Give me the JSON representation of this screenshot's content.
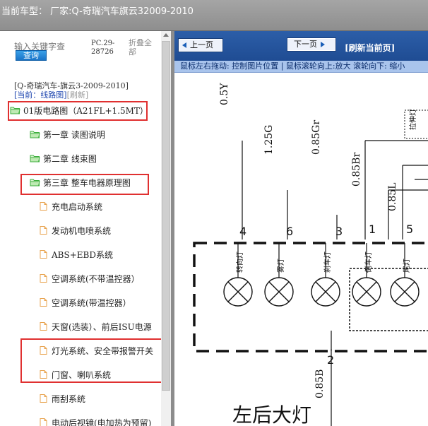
{
  "header": {
    "title": "当前车型：  厂家:Q-奇瑞汽车旗云32009-2010"
  },
  "sidebar": {
    "search_placeholder": "输入关键字查",
    "search_button": "查询",
    "model_code": "PC.29-28726",
    "collapse_all": "折叠全部",
    "breadcrumb_path": "[Q-奇瑞汽车-旗云3-2009-2010]",
    "breadcrumb_current": "[当前：线路图]",
    "breadcrumb_refresh": "[刷新]",
    "items": [
      {
        "label": "01版电路图（A21FL+1.5MT）",
        "icon": "folder-open-icon"
      },
      {
        "label": "第一章 读图说明",
        "icon": "folder-open-icon"
      },
      {
        "label": "第二章 线束图",
        "icon": "folder-open-icon"
      },
      {
        "label": "第三章 整车电器原理图",
        "icon": "folder-open-icon"
      },
      {
        "label": "充电启动系统",
        "icon": "document-icon"
      },
      {
        "label": "发动机电喷系统",
        "icon": "document-icon"
      },
      {
        "label": "ABS+EBD系统",
        "icon": "document-icon"
      },
      {
        "label": "空调系统(不带温控器）",
        "icon": "document-icon"
      },
      {
        "label": "空调系统(带温控器）",
        "icon": "document-icon"
      },
      {
        "label": "天窗(选装）、前后ISU电源",
        "icon": "document-icon"
      },
      {
        "label": "灯光系统、安全带报警开关",
        "icon": "document-icon"
      },
      {
        "label": "门窗、喇叭系统",
        "icon": "document-icon"
      },
      {
        "label": "雨刮系统",
        "icon": "document-icon"
      },
      {
        "label": "电动后视镜(电加热为预留)",
        "icon": "document-icon"
      }
    ]
  },
  "viewer": {
    "prev_page": "上一页",
    "next_page": "下一页",
    "refresh_page": "[刷新当前页]",
    "hint": "鼠标左右拖动: 控制图片位置 | 鼠标滚轮向上:放大  滚轮向下: 缩小"
  },
  "diagram": {
    "wire_labels": [
      "0.5Y",
      "1.25G",
      "0.85Gr",
      "0.85Br",
      "0.85L",
      "0.85B"
    ],
    "pin_numbers": [
      "4",
      "6",
      "3",
      "1",
      "5",
      "2"
    ],
    "lamp_labels": [
      "转向灯",
      "雾灯",
      "刹车灯",
      "倒车灯",
      "尾灯"
    ],
    "box_label": "拉伸灯",
    "title": "左后大灯"
  },
  "colors": {
    "highlight": "#e03030",
    "nav_bg": "#2c5ea8",
    "hint_bg": "#a9c4ec",
    "folder": "#3cae3c",
    "document": "#e8a34e"
  }
}
